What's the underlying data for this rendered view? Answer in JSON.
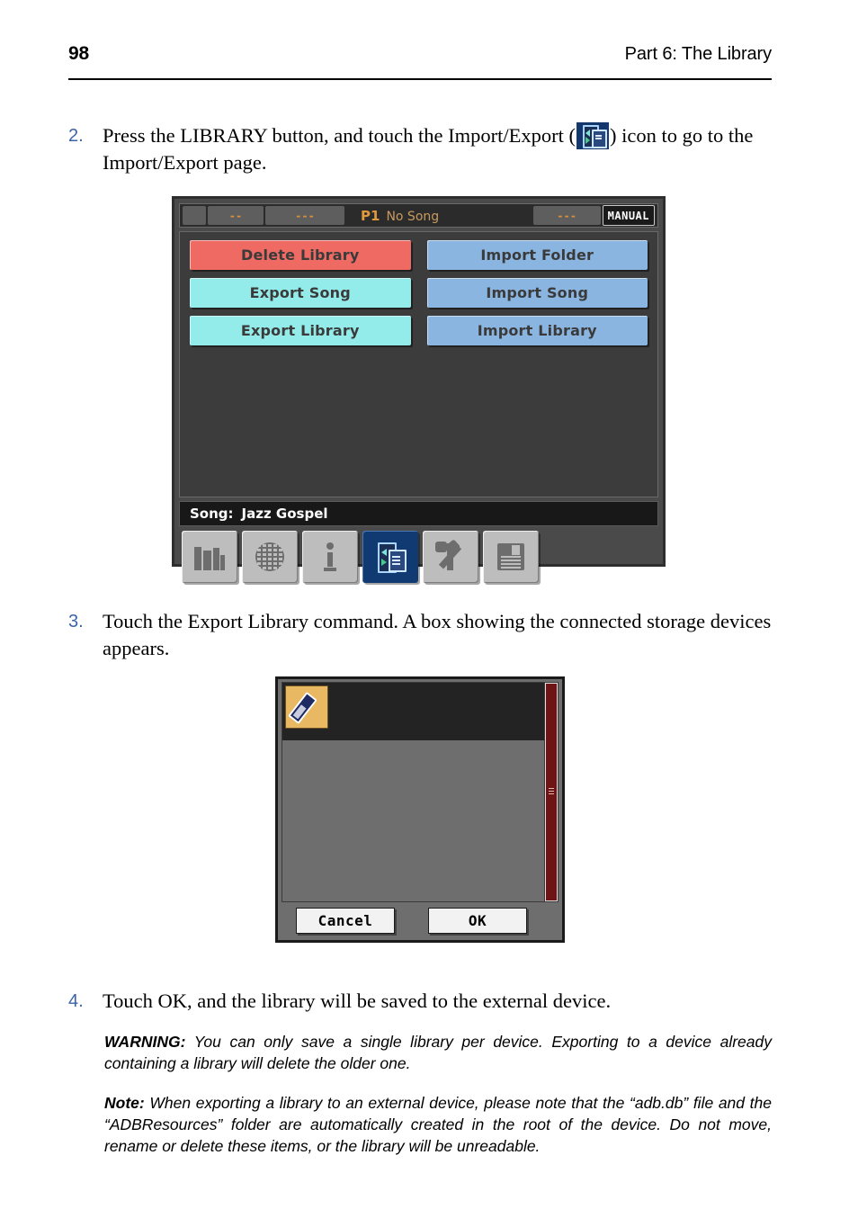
{
  "header": {
    "page_number": "98",
    "title": "Part 6: The Library"
  },
  "steps": {
    "step2": {
      "number": "2.",
      "text_before_icon": "Press the LIBRARY button, and touch the Import/Export (",
      "icon_name": "import-export-icon",
      "text_after_icon": ") icon to go to the Import/Export page."
    },
    "step3": {
      "number": "3.",
      "text": "Touch the Export Library command. A box showing the connected storage devices appears."
    },
    "step4": {
      "number": "4.",
      "text": "Touch OK, and the library will be saved to the external device."
    }
  },
  "device_screen": {
    "status_bar": {
      "segment1": "",
      "segment2": "--",
      "segment3": "---",
      "song_id": "P1",
      "song_name": "No Song",
      "segment4": "---",
      "mode_badge": "MANUAL"
    },
    "buttons": [
      {
        "label": "Delete Library",
        "color": "#ef6a63",
        "style": "red"
      },
      {
        "label": "Import Folder",
        "color": "#8ab5e0",
        "style": "blue"
      },
      {
        "label": "Export Song",
        "color": "#93ecea",
        "style": "cyan"
      },
      {
        "label": "Import Song",
        "color": "#8ab5e0",
        "style": "blue"
      },
      {
        "label": "Export Library",
        "color": "#93ecea",
        "style": "cyan"
      },
      {
        "label": "Import Library",
        "color": "#8ab5e0",
        "style": "blue"
      }
    ],
    "song_bar": {
      "label": "Song:",
      "value": "Jazz Gospel"
    },
    "toolbar": [
      {
        "icon": "books-icon",
        "selected": false
      },
      {
        "icon": "globe-icon",
        "selected": false
      },
      {
        "icon": "info-icon",
        "selected": false
      },
      {
        "icon": "import-export-icon",
        "selected": true
      },
      {
        "icon": "tools-icon",
        "selected": false
      },
      {
        "icon": "save-disk-icon",
        "selected": false
      }
    ]
  },
  "dialog": {
    "device_icon": "usb-device-icon",
    "cancel_label": "Cancel",
    "ok_label": "OK",
    "scrollbar_color": "#6e1414"
  },
  "callouts": {
    "warning_label": "WARNING:",
    "warning_text": " You can only save a single library per device. Exporting to a device already containing a library will delete the older one.",
    "note_label": "Note:",
    "note_text": " When exporting a library to an external device, please note that the “adb.db” file and the “ADBResources” folder are  automatically created in the root of the device. Do not move, rename or delete these items, or the library will be unreadable."
  },
  "colors": {
    "step_number": "#3c64aa",
    "accent_orange": "#e09a3e",
    "selected_tab": "#123a72"
  }
}
